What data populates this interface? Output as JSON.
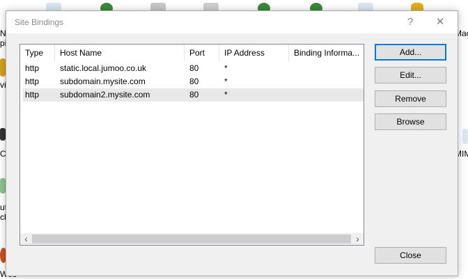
{
  "background": {
    "fragments": [
      "NE",
      "pil",
      "vic",
      "CG",
      "utp",
      "chi",
      "Web",
      "Mac",
      "MIM"
    ]
  },
  "dialog": {
    "title": "Site Bindings",
    "help_glyph": "?",
    "close_glyph": "✕"
  },
  "table": {
    "columns": [
      "Type",
      "Host Name",
      "Port",
      "IP Address",
      "Binding Informa..."
    ],
    "rows": [
      {
        "type": "http",
        "host": "static.local.jumoo.co.uk",
        "port": "80",
        "ip": "*",
        "info": ""
      },
      {
        "type": "http",
        "host": "subdomain.mysite.com",
        "port": "80",
        "ip": "*",
        "info": ""
      },
      {
        "type": "http",
        "host": "subdomain2.mysite.com",
        "port": "80",
        "ip": "*",
        "info": ""
      }
    ],
    "scroll_left": "‹",
    "scroll_right": "›"
  },
  "buttons": {
    "add": "Add...",
    "edit": "Edit...",
    "remove": "Remove",
    "browse": "Browse",
    "close": "Close"
  },
  "colors": {
    "accent": "#0078d7",
    "selected_row": "#e8e8e8"
  }
}
